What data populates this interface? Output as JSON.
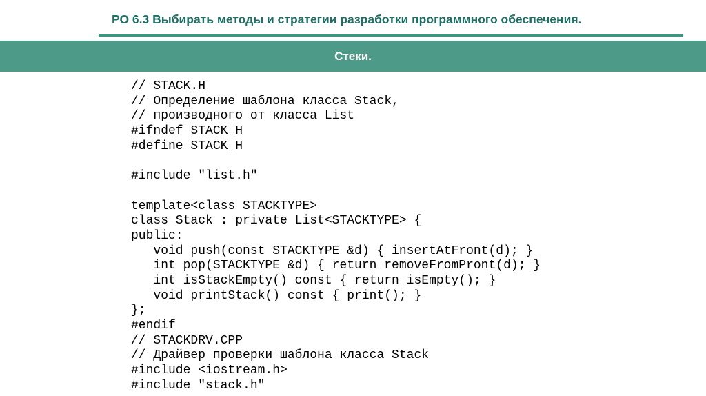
{
  "slide": {
    "title": "РО 6.3 Выбирать методы и стратегии разработки программного обеспечения.",
    "section": "Стеки."
  },
  "code": {
    "lines": [
      "// STACK.H",
      "// Определение шаблона класса Stack,",
      "// производного от класса List",
      "#ifndef STACK_H",
      "#define STACK_H",
      "",
      "#include \"list.h\"",
      "",
      "template<class STACKTYPE>",
      "class Stack : private List<STACKTYPE> {",
      "public:",
      "   void push(const STACKTYPE &d) { insertAtFront(d); }",
      "   int pop(STACKTYPE &d) { return removeFromPront(d); }",
      "   int isStackEmpty() const { return isEmpty(); }",
      "   void printStack() const { print(); }",
      "};",
      "#endif",
      "// STACKDRV.CPP",
      "// Драйвер проверки шаблона класса Stack",
      "#include <iostream.h>",
      "#include \"stack.h\""
    ]
  }
}
